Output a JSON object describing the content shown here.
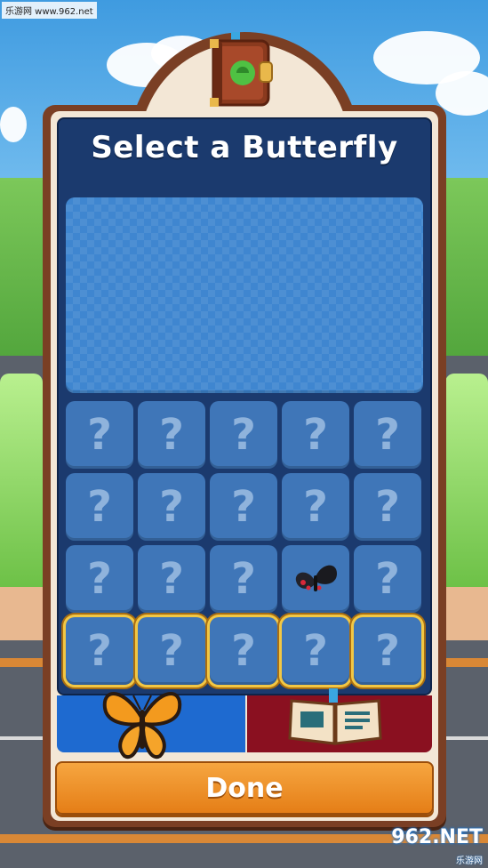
{
  "watermark": {
    "site": "乐游网 www.962.net",
    "logo": "962.NET",
    "logo_sub": "乐游网"
  },
  "header": {
    "title": "Select a Butterfly"
  },
  "grid": {
    "rows": [
      [
        "?",
        "?",
        "?",
        "?",
        "?"
      ],
      [
        "?",
        "?",
        "?",
        "?",
        "?"
      ],
      [
        "?",
        "?",
        "?",
        "butterfly",
        "?"
      ],
      [
        "?",
        "?",
        "?",
        "?",
        "?"
      ]
    ],
    "highlighted_row": 3
  },
  "tabs": [
    {
      "name": "butterfly-tab",
      "icon": "monarch-butterfly-icon",
      "active": true,
      "color": "#1e6ad0"
    },
    {
      "name": "journal-tab",
      "icon": "open-book-icon",
      "active": false,
      "color": "#8a1020"
    }
  ],
  "footer": {
    "done_label": "Done"
  },
  "colors": {
    "frame": "#7a3f24",
    "panel": "#1b3a6e",
    "slot": "#3f76b8",
    "done": "#f29a2e",
    "gold": "#f2c744"
  }
}
